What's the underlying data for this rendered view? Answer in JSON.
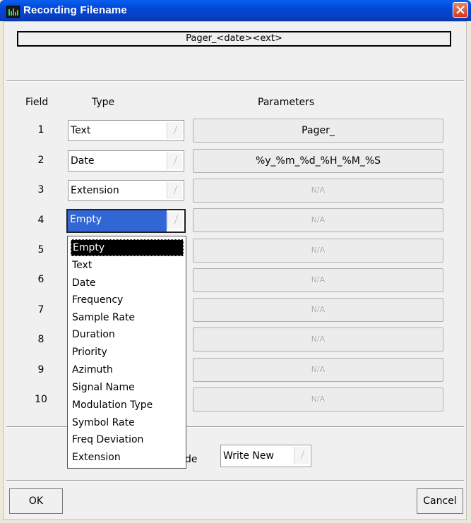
{
  "window": {
    "title": "Recording Filename",
    "icon": "audio-meter-icon",
    "close_icon": "close-icon",
    "titlebar_color": "#0a4fe0"
  },
  "filename_preview": "Pager_<date><ext>",
  "headers": {
    "field": "Field",
    "type": "Type",
    "parameters": "Parameters"
  },
  "rows": [
    {
      "field": "1",
      "type": "Text",
      "parameter": "Pager_"
    },
    {
      "field": "2",
      "type": "Date",
      "parameter": "%y_%m_%d_%H_%M_%S"
    },
    {
      "field": "3",
      "type": "Extension",
      "parameter": "N/A"
    },
    {
      "field": "4",
      "type": "Empty",
      "parameter": "N/A"
    },
    {
      "field": "5",
      "parameter": "N/A"
    },
    {
      "field": "6",
      "parameter": "N/A"
    },
    {
      "field": "7",
      "parameter": "N/A"
    },
    {
      "field": "8",
      "parameter": "N/A"
    },
    {
      "field": "9",
      "parameter": "N/A"
    },
    {
      "field": "10",
      "parameter": "N/A"
    }
  ],
  "dropdown": {
    "selected": "Empty",
    "options": [
      "Empty",
      "Text",
      "Date",
      "Frequency",
      "Sample Rate",
      "Duration",
      "Priority",
      "Azimuth",
      "Signal Name",
      "Modulation Type",
      "Symbol Rate",
      "Freq Deviation",
      "Extension"
    ]
  },
  "mode": {
    "label_visible": "de",
    "value": "Write New"
  },
  "buttons": {
    "ok": "OK",
    "cancel": "Cancel"
  },
  "colors": {
    "selection": "#3166d4",
    "dialog_bg": "#f0f0f0"
  }
}
